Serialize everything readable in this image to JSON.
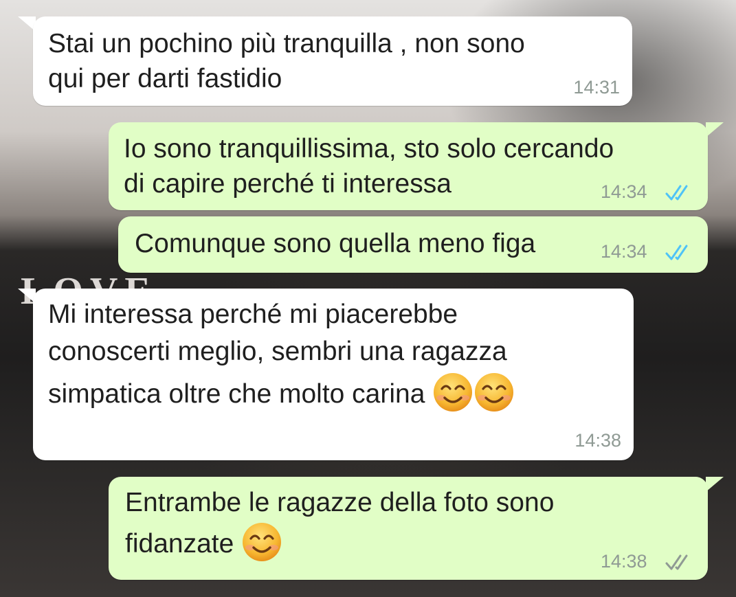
{
  "wallpaper": {
    "overlay_text": "LOVE"
  },
  "colors": {
    "incoming_bubble": "#ffffff",
    "outgoing_bubble": "#e1fec6",
    "read_tick": "#4fc3f7",
    "delivered_tick": "#8f9a94",
    "timestamp": "#8f9a94"
  },
  "messages": [
    {
      "direction": "incoming",
      "lines": [
        "Stai un pochino più tranquilla , non sono",
        "qui per darti fastidio"
      ],
      "time": "14:31"
    },
    {
      "direction": "outgoing",
      "lines": [
        "Io sono tranquillissima, sto solo cercando",
        "di capire perché ti interessa"
      ],
      "time": "14:34",
      "status": "read"
    },
    {
      "direction": "outgoing",
      "lines": [
        "Comunque sono quella meno figa"
      ],
      "time": "14:34",
      "status": "read"
    },
    {
      "direction": "incoming",
      "lines": [
        "Mi interessa perché mi piacerebbe",
        "conoscerti meglio, sembri una ragazza",
        "simpatica oltre che molto carina"
      ],
      "emojis": [
        "smiling-face-icon",
        "smiling-face-icon"
      ],
      "time": "14:38"
    },
    {
      "direction": "outgoing",
      "lines": [
        "Entrambe le ragazze della foto sono",
        "fidanzate"
      ],
      "emojis": [
        "smiling-face-icon"
      ],
      "time": "14:38",
      "status": "delivered"
    }
  ]
}
